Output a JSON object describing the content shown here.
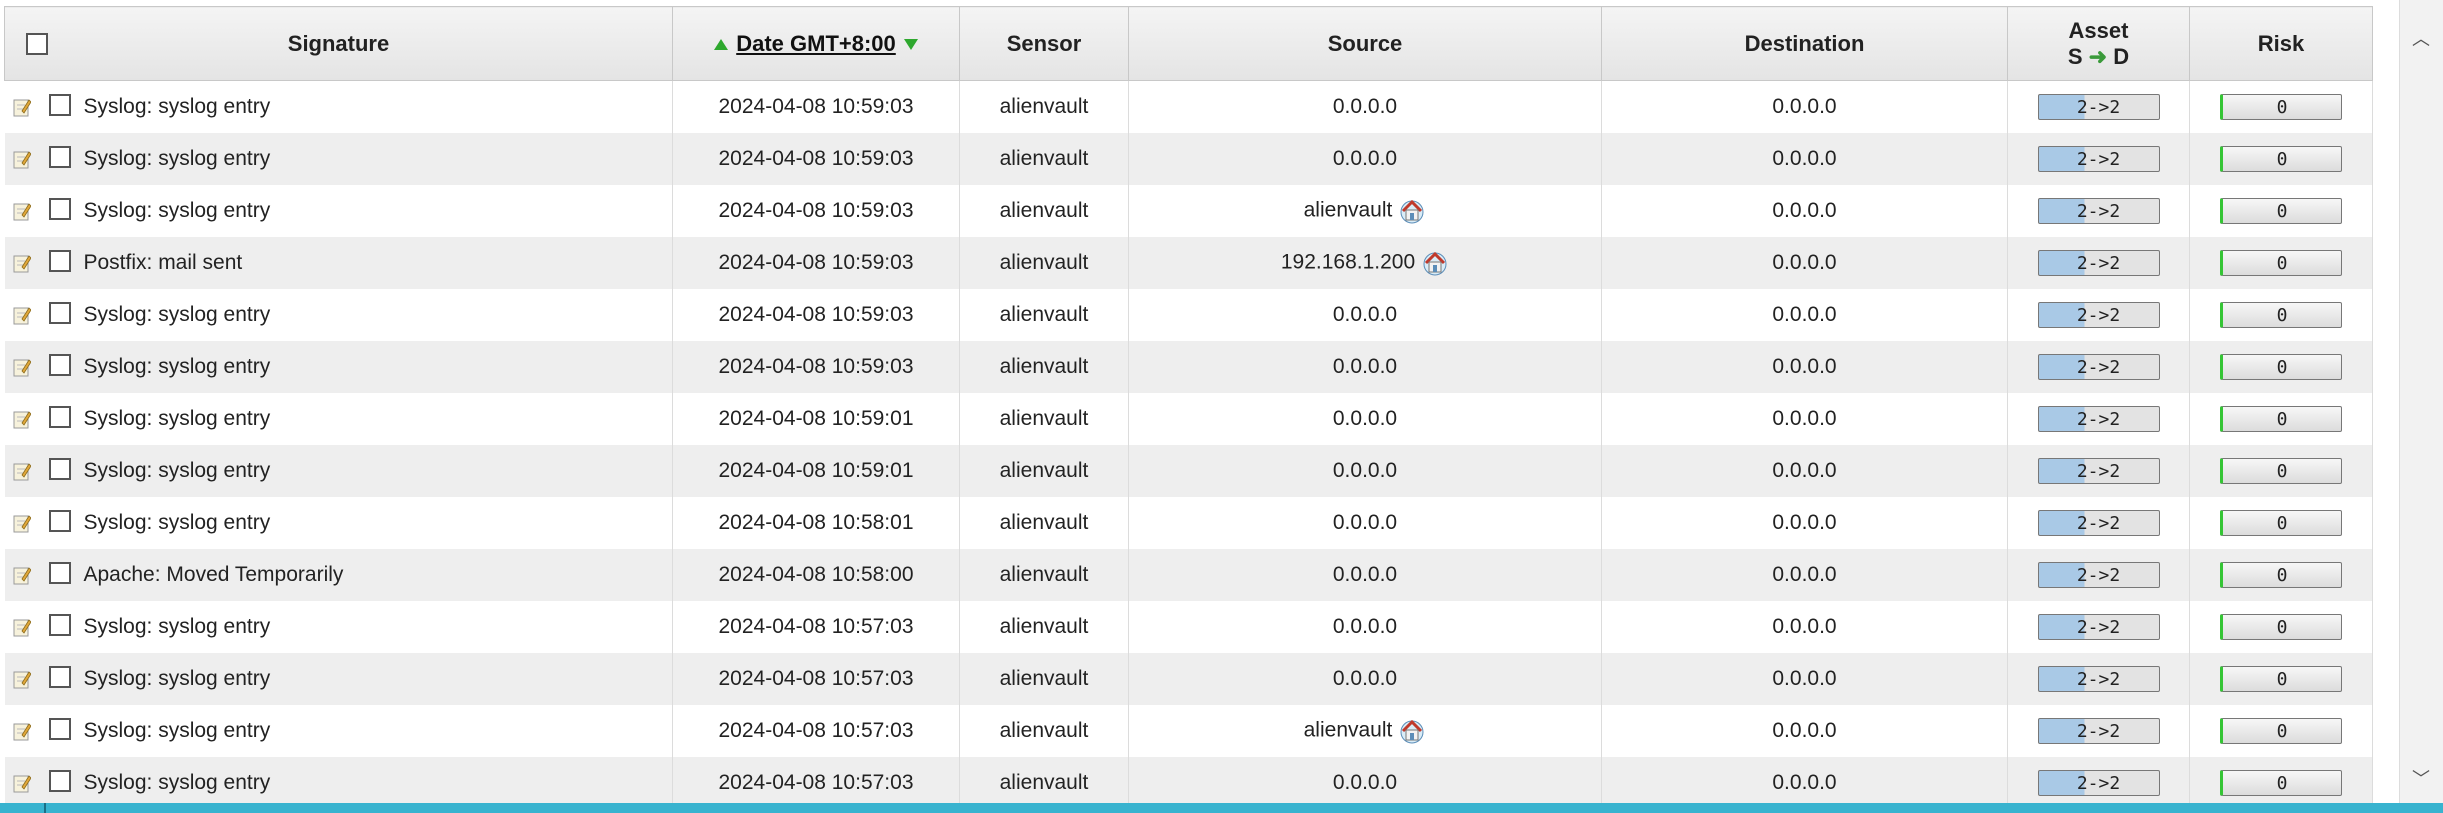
{
  "columns": {
    "signature": "Signature",
    "date": "Date GMT+8:00",
    "sensor": "Sensor",
    "source": "Source",
    "destination": "Destination",
    "asset_line1": "Asset",
    "asset_s": "S",
    "asset_arrow": "➜",
    "asset_d": "D",
    "risk": "Risk"
  },
  "rows": [
    {
      "signature": "Syslog: syslog entry",
      "date": "2024-04-08 10:59:03",
      "sensor": "alienvault",
      "source": "0.0.0.0",
      "source_host_icon": false,
      "destination": "0.0.0.0",
      "asset": "2->2",
      "risk": "0"
    },
    {
      "signature": "Syslog: syslog entry",
      "date": "2024-04-08 10:59:03",
      "sensor": "alienvault",
      "source": "0.0.0.0",
      "source_host_icon": false,
      "destination": "0.0.0.0",
      "asset": "2->2",
      "risk": "0"
    },
    {
      "signature": "Syslog: syslog entry",
      "date": "2024-04-08 10:59:03",
      "sensor": "alienvault",
      "source": "alienvault",
      "source_host_icon": true,
      "destination": "0.0.0.0",
      "asset": "2->2",
      "risk": "0"
    },
    {
      "signature": "Postfix: mail sent",
      "date": "2024-04-08 10:59:03",
      "sensor": "alienvault",
      "source": "192.168.1.200",
      "source_host_icon": true,
      "destination": "0.0.0.0",
      "asset": "2->2",
      "risk": "0"
    },
    {
      "signature": "Syslog: syslog entry",
      "date": "2024-04-08 10:59:03",
      "sensor": "alienvault",
      "source": "0.0.0.0",
      "source_host_icon": false,
      "destination": "0.0.0.0",
      "asset": "2->2",
      "risk": "0"
    },
    {
      "signature": "Syslog: syslog entry",
      "date": "2024-04-08 10:59:03",
      "sensor": "alienvault",
      "source": "0.0.0.0",
      "source_host_icon": false,
      "destination": "0.0.0.0",
      "asset": "2->2",
      "risk": "0"
    },
    {
      "signature": "Syslog: syslog entry",
      "date": "2024-04-08 10:59:01",
      "sensor": "alienvault",
      "source": "0.0.0.0",
      "source_host_icon": false,
      "destination": "0.0.0.0",
      "asset": "2->2",
      "risk": "0"
    },
    {
      "signature": "Syslog: syslog entry",
      "date": "2024-04-08 10:59:01",
      "sensor": "alienvault",
      "source": "0.0.0.0",
      "source_host_icon": false,
      "destination": "0.0.0.0",
      "asset": "2->2",
      "risk": "0"
    },
    {
      "signature": "Syslog: syslog entry",
      "date": "2024-04-08 10:58:01",
      "sensor": "alienvault",
      "source": "0.0.0.0",
      "source_host_icon": false,
      "destination": "0.0.0.0",
      "asset": "2->2",
      "risk": "0"
    },
    {
      "signature": "Apache: Moved Temporarily",
      "date": "2024-04-08 10:58:00",
      "sensor": "alienvault",
      "source": "0.0.0.0",
      "source_host_icon": false,
      "destination": "0.0.0.0",
      "asset": "2->2",
      "risk": "0"
    },
    {
      "signature": "Syslog: syslog entry",
      "date": "2024-04-08 10:57:03",
      "sensor": "alienvault",
      "source": "0.0.0.0",
      "source_host_icon": false,
      "destination": "0.0.0.0",
      "asset": "2->2",
      "risk": "0"
    },
    {
      "signature": "Syslog: syslog entry",
      "date": "2024-04-08 10:57:03",
      "sensor": "alienvault",
      "source": "0.0.0.0",
      "source_host_icon": false,
      "destination": "0.0.0.0",
      "asset": "2->2",
      "risk": "0"
    },
    {
      "signature": "Syslog: syslog entry",
      "date": "2024-04-08 10:57:03",
      "sensor": "alienvault",
      "source": "alienvault",
      "source_host_icon": true,
      "destination": "0.0.0.0",
      "asset": "2->2",
      "risk": "0"
    },
    {
      "signature": "Syslog: syslog entry",
      "date": "2024-04-08 10:57:03",
      "sensor": "alienvault",
      "source": "0.0.0.0",
      "source_host_icon": false,
      "destination": "0.0.0.0",
      "asset": "2->2",
      "risk": "0"
    }
  ],
  "icons": {
    "row_edit": "edit-note-icon",
    "host": "host-home-icon",
    "sort_asc": "sort-ascending-icon",
    "sort_desc": "sort-descending-icon",
    "scroll_up": "scroll-up-icon",
    "scroll_down": "scroll-down-icon"
  },
  "colors": {
    "header_bg": "#e9e9e9",
    "row_alt_bg": "#eeeeee",
    "sort_arrow": "#2ea82e",
    "asset_fill": "#a9c9e6",
    "risk_indicator": "#35c535",
    "bottom_bar": "#38b3cf"
  }
}
